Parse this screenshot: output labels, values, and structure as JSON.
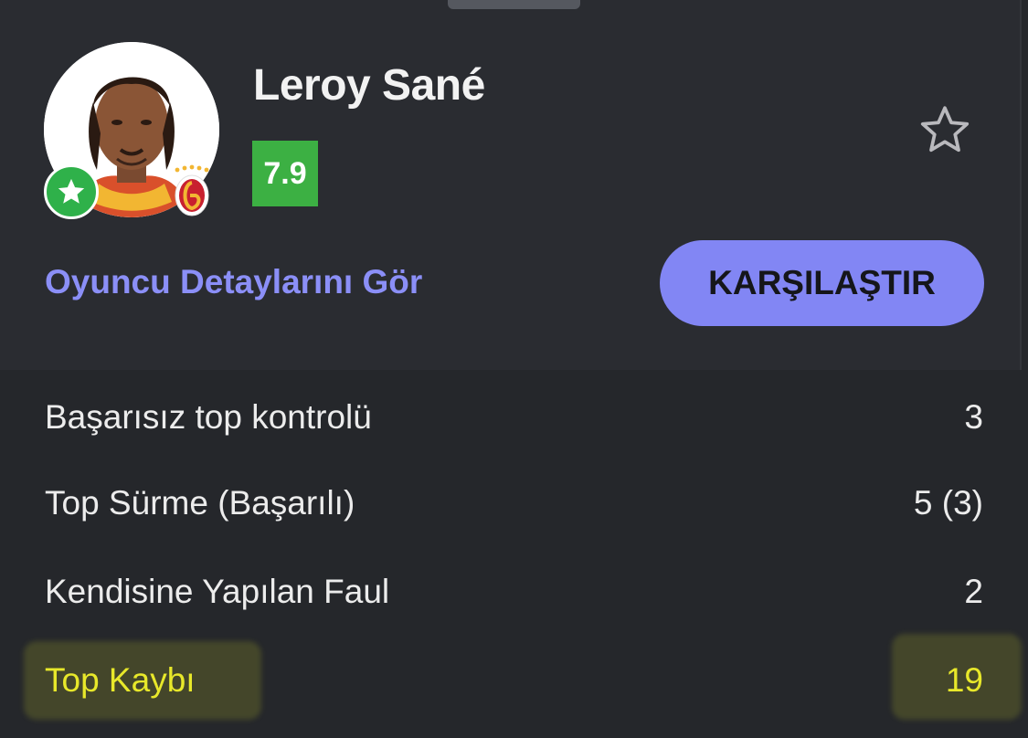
{
  "player": {
    "name": "Leroy Sané",
    "rating": "7.9"
  },
  "actions": {
    "details_link": "Oyuncu Detaylarını Gör",
    "compare_button": "KARŞILAŞTIR"
  },
  "icons": {
    "position_badge": "star-icon",
    "club_badge": "galatasaray-crest-icon",
    "favorite": "star-outline-icon"
  },
  "colors": {
    "rating_bg": "#3cb043",
    "accent": "#8286f4",
    "link": "#8b8ff7",
    "highlight_text": "#e8e82a"
  },
  "stats": [
    {
      "label": "Başarısız top kontrolü",
      "value": "3"
    },
    {
      "label": "Top Sürme (Başarılı)",
      "value": "5 (3)"
    },
    {
      "label": "Kendisine Yapılan Faul",
      "value": "2"
    },
    {
      "label": "Top Kaybı",
      "value": "19",
      "highlighted": true
    }
  ]
}
